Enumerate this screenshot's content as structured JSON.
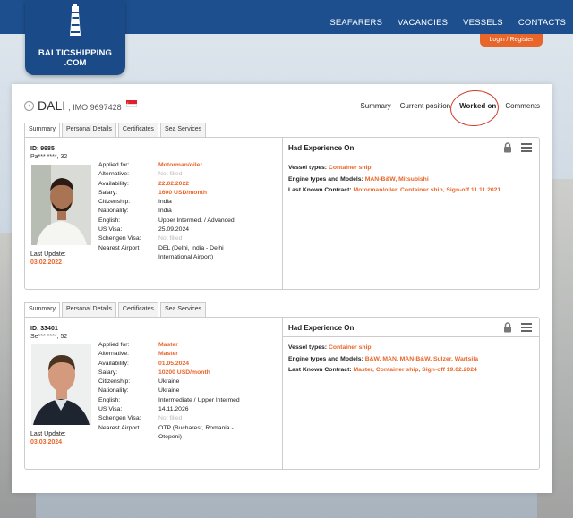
{
  "site": {
    "logo_line1": "BALTICSHIPPING",
    "logo_line2": ".COM",
    "nav": [
      "SEAFARERS",
      "VACANCIES",
      "VESSELS",
      "CONTACTS"
    ],
    "login": "Login",
    "register": "Register",
    "login_sep": "/"
  },
  "vessel": {
    "name": "DALI",
    "imo": ", IMO 9697428",
    "tabs": [
      "Summary",
      "Current position",
      "Worked on",
      "Comments"
    ],
    "active_tab": "Worked on"
  },
  "card_tabs": [
    "Summary",
    "Personal Details",
    "Certificates",
    "Sea Services"
  ],
  "labels": {
    "applied_for": "Applied for:",
    "alternative": "Alternative:",
    "availability": "Availability:",
    "salary": "Salary:",
    "citizenship": "Citizenship:",
    "nationality": "Nationality:",
    "english": "English:",
    "us_visa": "US Visa:",
    "schengen_visa": "Schengen Visa:",
    "nearest_airport": "Nearest Airport",
    "last_update": "Last Update:",
    "had_experience": "Had Experience On",
    "vessel_types": "Vessel types:",
    "engine_types": "Engine types and Models:",
    "last_contract": "Last Known Contract:"
  },
  "seafarers": [
    {
      "id": "ID: 9985",
      "masked": "Pa*** ****, 32",
      "applied_for": "Motorman/oiler",
      "alternative": "Not filled",
      "availability": "22.02.2022",
      "salary": "1600 USD/month",
      "citizenship": "India",
      "nationality": "India",
      "english": "Upper Intermed. / Advanced",
      "us_visa": "25.09.2024",
      "schengen_visa": "Not filled",
      "nearest_airport": "DEL (Delhi, India - Delhi International Airport)",
      "last_update": "03.02.2022",
      "vessel_types": "Container ship",
      "engine_types": "MAN-B&W, Mitsubishi",
      "last_contract": "Motorman/oiler, Container ship, Sign-off 11.11.2021"
    },
    {
      "id": "ID: 33401",
      "masked": "Se*** ****, 52",
      "applied_for": "Master",
      "alternative": "Master",
      "availability": "01.05.2024",
      "salary": "10200 USD/month",
      "citizenship": "Ukraine",
      "nationality": "Ukraine",
      "english": "Intermediate / Upper Intermed",
      "us_visa": "14.11.2026",
      "schengen_visa": "Not filled",
      "nearest_airport": "OTP (Bucharest, Romania - Otopeni)",
      "last_update": "03.03.2024",
      "vessel_types": "Container ship",
      "engine_types": "B&W, MAN, MAN-B&W, Sulzer, Wartsila",
      "last_contract": "Master, Container ship, Sign-off 19.02.2024"
    }
  ],
  "colors": {
    "brand_blue": "#1d4f8f",
    "accent_orange": "#e8662a",
    "circle_red": "#d23a2a"
  }
}
